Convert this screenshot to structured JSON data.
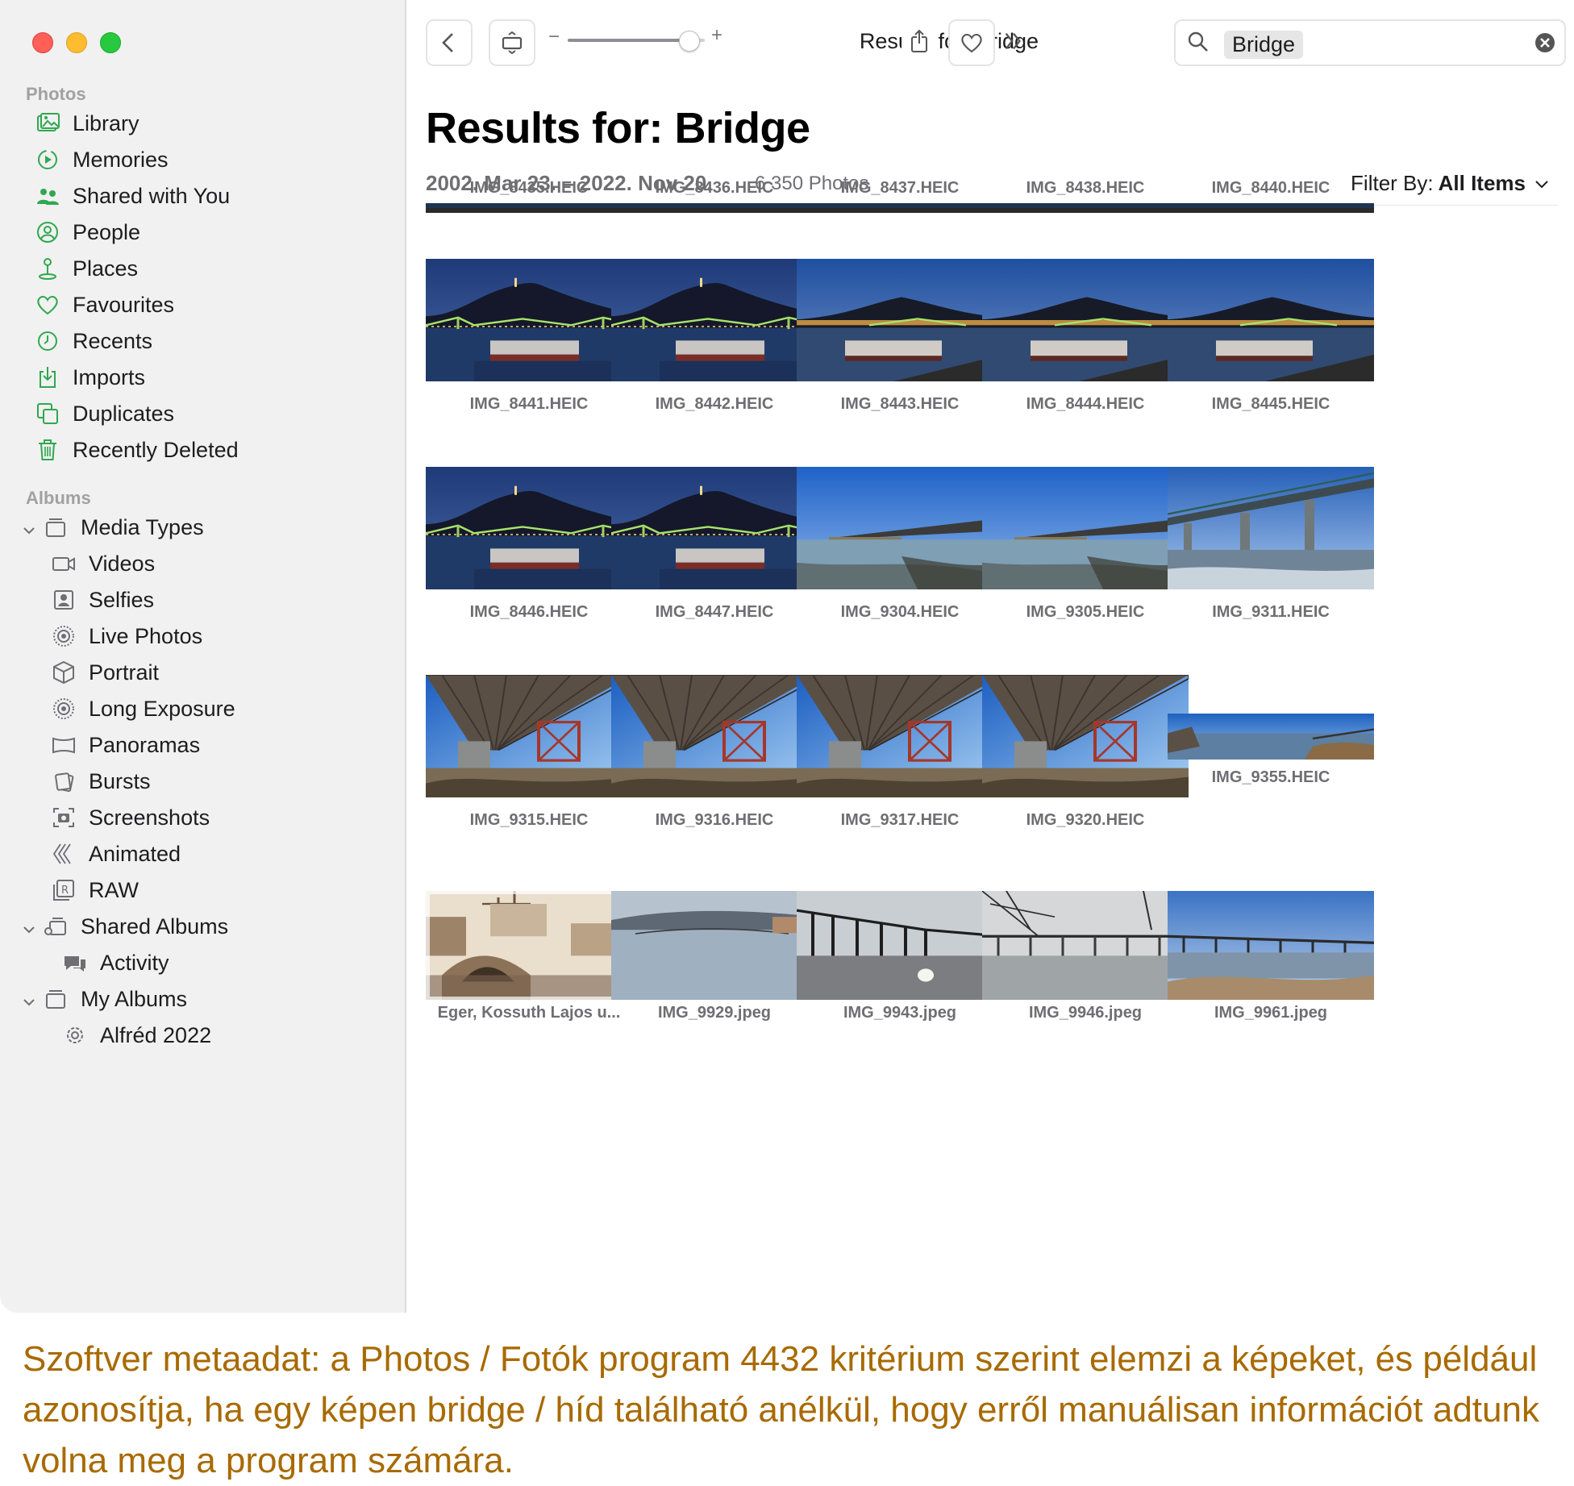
{
  "sidebar": {
    "photos_section": "Photos",
    "photos_items": [
      {
        "label": "Library",
        "icon": "library-icon"
      },
      {
        "label": "Memories",
        "icon": "memories-icon"
      },
      {
        "label": "Shared with You",
        "icon": "shared-with-you-icon"
      },
      {
        "label": "People",
        "icon": "people-icon"
      },
      {
        "label": "Places",
        "icon": "places-icon"
      },
      {
        "label": "Favourites",
        "icon": "heart-icon"
      },
      {
        "label": "Recents",
        "icon": "clock-icon"
      },
      {
        "label": "Imports",
        "icon": "import-icon"
      },
      {
        "label": "Duplicates",
        "icon": "duplicates-icon"
      },
      {
        "label": "Recently Deleted",
        "icon": "trash-icon"
      }
    ],
    "albums_section": "Albums",
    "media_types": {
      "label": "Media Types",
      "icon": "album-stack-icon"
    },
    "media_type_items": [
      {
        "label": "Videos",
        "icon": "video-icon"
      },
      {
        "label": "Selfies",
        "icon": "selfie-icon"
      },
      {
        "label": "Live Photos",
        "icon": "live-photo-icon"
      },
      {
        "label": "Portrait",
        "icon": "portrait-cube-icon"
      },
      {
        "label": "Long Exposure",
        "icon": "long-exposure-icon"
      },
      {
        "label": "Panoramas",
        "icon": "panorama-icon"
      },
      {
        "label": "Bursts",
        "icon": "bursts-icon"
      },
      {
        "label": "Screenshots",
        "icon": "screenshot-icon"
      },
      {
        "label": "Animated",
        "icon": "animated-icon"
      },
      {
        "label": "RAW",
        "icon": "raw-icon"
      }
    ],
    "shared_albums": {
      "label": "Shared Albums",
      "icon": "shared-album-icon"
    },
    "activity": {
      "label": "Activity",
      "icon": "activity-icon"
    },
    "my_albums": {
      "label": "My Albums",
      "icon": "album-stack-icon"
    },
    "alfred": {
      "label": "Alfréd 2022",
      "icon": "gear-icon"
    }
  },
  "toolbar": {
    "title": "Results for: Bridge",
    "search_token": "Bridge",
    "zoom_minus": "−",
    "zoom_plus": "+",
    "zoom_level": 0.88
  },
  "header": {
    "title": "Results for: Bridge",
    "date_range": "2002. Mar 23. – 2022. Nov 20.",
    "count": "6 350 Photos",
    "filter_prefix": "Filter By:",
    "filter_value": "All Items"
  },
  "rows": [
    [
      {
        "name": "IMG_8435.HEIC",
        "scene": "partial"
      },
      {
        "name": "IMG_8436.HEIC",
        "scene": "partial"
      },
      {
        "name": "IMG_8437.HEIC",
        "scene": "partial"
      },
      {
        "name": "IMG_8438.HEIC",
        "scene": "partial"
      },
      {
        "name": "IMG_8440.HEIC",
        "scene": "partial"
      }
    ],
    [
      {
        "name": "IMG_8441.HEIC",
        "scene": "night"
      },
      {
        "name": "IMG_8442.HEIC",
        "scene": "night"
      },
      {
        "name": "IMG_8443.HEIC",
        "scene": "dusk"
      },
      {
        "name": "IMG_8444.HEIC",
        "scene": "dusk"
      },
      {
        "name": "IMG_8445.HEIC",
        "scene": "dusk"
      }
    ],
    [
      {
        "name": "IMG_8446.HEIC",
        "scene": "night"
      },
      {
        "name": "IMG_8447.HEIC",
        "scene": "night"
      },
      {
        "name": "IMG_9304.HEIC",
        "scene": "lake"
      },
      {
        "name": "IMG_9305.HEIC",
        "scene": "lake"
      },
      {
        "name": "IMG_9311.HEIC",
        "scene": "railbridge"
      }
    ],
    [
      {
        "name": "IMG_9315.HEIC",
        "scene": "under"
      },
      {
        "name": "IMG_9316.HEIC",
        "scene": "under"
      },
      {
        "name": "IMG_9317.HEIC",
        "scene": "under"
      },
      {
        "name": "IMG_9320.HEIC",
        "scene": "under"
      },
      {
        "name": "IMG_9355.HEIC",
        "scene": "panorama"
      }
    ],
    [
      {
        "name": "Eger, Kossuth Lajos u...",
        "scene": "sepia"
      },
      {
        "name": "IMG_9929.jpeg",
        "scene": "lakebridge"
      },
      {
        "name": "IMG_9943.jpeg",
        "scene": "pier"
      },
      {
        "name": "IMG_9946.jpeg",
        "scene": "fogpier"
      },
      {
        "name": "IMG_9961.jpeg",
        "scene": "pier2"
      }
    ]
  ],
  "caption": "Szoftver metaadat: a Photos / Fotók program 4432 kritérium szerint elemzi a képeket, és például azonosítja, ha egy képen bridge / híd található anélkül, hogy erről manuálisan információt adtunk volna meg a program számára.",
  "colors": {
    "accent_green": "#34a853",
    "caption_color": "#a86a00",
    "sidebar_bg": "#f1f1f1"
  }
}
